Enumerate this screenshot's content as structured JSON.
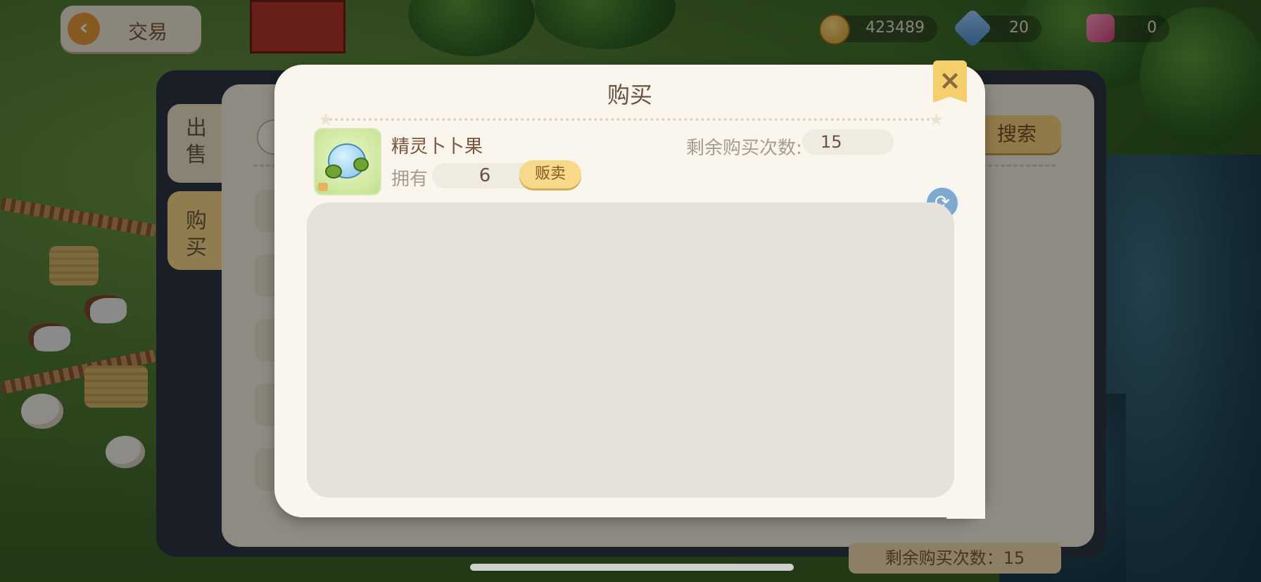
{
  "header": {
    "back_label": "交易",
    "coins": "423489",
    "gems": "20",
    "hearts": "0"
  },
  "trade_panel": {
    "tabs": [
      {
        "label_line1": "出",
        "label_line2": "售"
      },
      {
        "label_line1": "购",
        "label_line2": "买"
      }
    ],
    "search_label": "搜索",
    "remaining_label": "剩余购买次数：15"
  },
  "purchase_modal": {
    "title": "购买",
    "item_name": "精灵卜卜果",
    "owned_label": "拥有",
    "owned_value": "6",
    "sell_label": "贩卖",
    "remaining_label": "剩余购买次数:",
    "remaining_value": "15"
  },
  "icons": {
    "back": "chevron-left-icon",
    "close": "close-icon",
    "refresh": "refresh-icon",
    "coin": "coin-icon",
    "gem": "gem-icon",
    "heart": "heart-icon"
  }
}
